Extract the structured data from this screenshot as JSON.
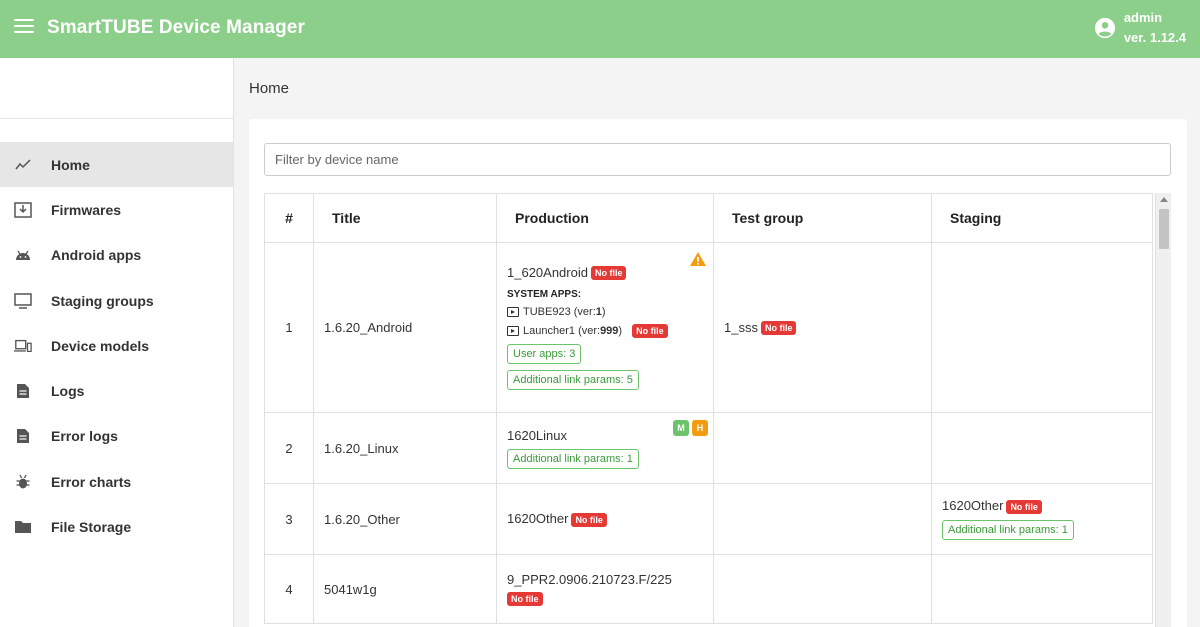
{
  "app": {
    "title": "SmartTUBE Device Manager",
    "user": "admin",
    "version": "ver. 1.12.4"
  },
  "colors": {
    "topbar": "#8ccf8a",
    "badge_red": "#e53935",
    "outline_green": "#6cc46a",
    "warning_orange": "#f39c12"
  },
  "sidebar": {
    "items": [
      {
        "label": "Home",
        "icon": "trend-line-icon",
        "active": true
      },
      {
        "label": "Firmwares",
        "icon": "download-tray-icon"
      },
      {
        "label": "Android apps",
        "icon": "android-icon"
      },
      {
        "label": "Staging groups",
        "icon": "monitor-icon"
      },
      {
        "label": "Device models",
        "icon": "devices-icon"
      },
      {
        "label": "Logs",
        "icon": "document-icon"
      },
      {
        "label": "Error logs",
        "icon": "document-icon"
      },
      {
        "label": "Error charts",
        "icon": "bug-icon"
      },
      {
        "label": "File Storage",
        "icon": "folder-icon"
      }
    ]
  },
  "breadcrumb": "Home",
  "filter": {
    "placeholder": "Filter by device name",
    "value": ""
  },
  "table": {
    "headers": [
      "#",
      "Title",
      "Production",
      "Test group",
      "Staging"
    ],
    "rows": [
      {
        "num": "1",
        "title": "1.6.20_Android",
        "production": {
          "name": "1_620Android",
          "badge": "No file",
          "system_title": "SYSTEM APPS:",
          "apps": [
            {
              "name": "TUBE923",
              "ver_prefix": "(ver: ",
              "ver": "1",
              "ver_suffix": ")"
            },
            {
              "name": "Launcher1",
              "ver_prefix": "(ver: ",
              "ver": "999",
              "ver_suffix": ")",
              "badge": "No file"
            }
          ],
          "user_apps": "User apps: 3",
          "link_params": "Additional link params: 5"
        },
        "test_group": {
          "name": "1_sss",
          "badge": "No file"
        }
      },
      {
        "num": "2",
        "title": "1.6.20_Linux",
        "production": {
          "name": "1620Linux",
          "m": "M",
          "h": "H",
          "link_params": "Additional link params: 1"
        }
      },
      {
        "num": "3",
        "title": "1.6.20_Other",
        "production": {
          "name": "1620Other",
          "badge": "No file"
        },
        "staging": {
          "name": "1620Other",
          "badge": "No file",
          "link_params": "Additional link params: 1"
        }
      },
      {
        "num": "4",
        "title": "5041w1g",
        "production": {
          "name": "9_PPR2.0906.210723.F/225",
          "badge": "No file"
        }
      }
    ]
  }
}
